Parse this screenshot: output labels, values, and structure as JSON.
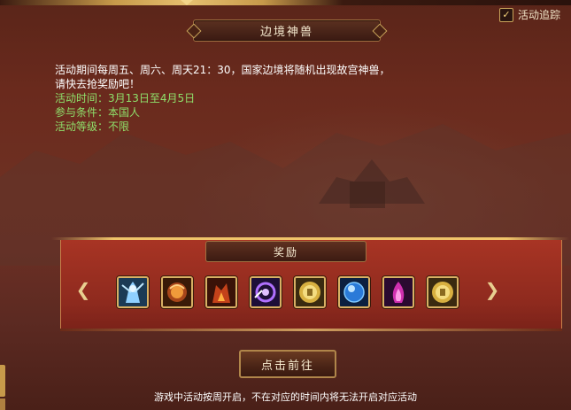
{
  "header": {
    "title": "边境神兽",
    "track_label": "活动追踪",
    "track_checked": true
  },
  "description": {
    "line1": "活动期间每周五、周六、周天21：30，国家边境将随机出现故宫神兽，",
    "line2": "请快去抢奖励吧！",
    "time": "活动时间：3月13日至4月5日",
    "condition": "参与条件：本国人",
    "level": "活动等级：不限"
  },
  "rewards": {
    "title": "奖励",
    "items": [
      {
        "icon": "ice-warrior-icon"
      },
      {
        "icon": "fire-orb-icon"
      },
      {
        "icon": "flame-armor-icon"
      },
      {
        "icon": "purple-vortex-icon"
      },
      {
        "icon": "gold-coin-icon"
      },
      {
        "icon": "blue-crystal-orb-icon"
      },
      {
        "icon": "magenta-flame-icon"
      },
      {
        "icon": "gold-coin-icon"
      }
    ]
  },
  "go_button": "点击前往",
  "notice": "游戏中活动按周开启，不在对应的时间内将无法开启对应活动",
  "colors": {
    "accent_gold": "#d8b064",
    "info_green": "#8fe06b",
    "panel_red": "#a83424"
  }
}
